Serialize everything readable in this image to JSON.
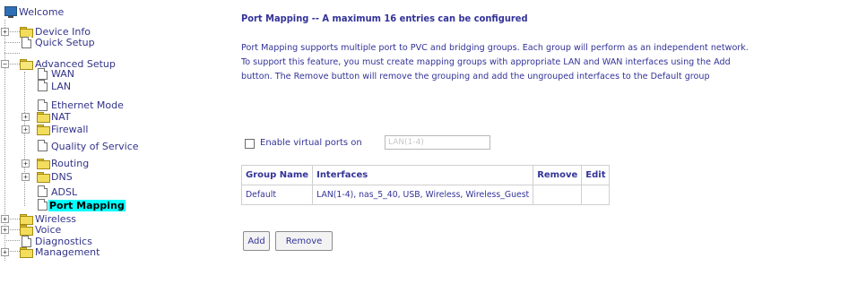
{
  "nav": {
    "items": [
      {
        "label": "Welcome"
      },
      {
        "label": "Device Info"
      },
      {
        "label": "Quick Setup"
      },
      {
        "label": "Advanced Setup"
      },
      {
        "label": "WAN"
      },
      {
        "label": "LAN"
      },
      {
        "label": "Ethernet Mode"
      },
      {
        "label": "NAT"
      },
      {
        "label": "Firewall"
      },
      {
        "label": "Quality of Service"
      },
      {
        "label": "Routing"
      },
      {
        "label": "DNS"
      },
      {
        "label": "ADSL"
      },
      {
        "label": "Port Mapping"
      },
      {
        "label": "Wireless"
      },
      {
        "label": "Voice"
      },
      {
        "label": "Diagnostics"
      },
      {
        "label": "Management"
      }
    ],
    "selected": "Port Mapping"
  },
  "page": {
    "title": "Port Mapping -- A maximum 16 entries can be configured",
    "description": [
      "Port Mapping supports multiple port to PVC and bridging groups. Each group will perform as an independent network.",
      "To support this feature, you must create mapping groups with appropriate LAN and WAN interfaces using the Add",
      "button. The Remove button will remove the grouping and add the ungrouped interfaces to the Default group"
    ],
    "virtual_ports": {
      "label": "Enable virtual ports on",
      "value": "LAN(1-4)",
      "checked": false
    },
    "table": {
      "headers": [
        "Group Name",
        "Interfaces",
        "Remove",
        "Edit"
      ],
      "rows": [
        {
          "group_name": "Default",
          "interfaces": "LAN(1-4), nas_5_40, USB, Wireless, Wireless_Guest",
          "remove": "",
          "edit": ""
        }
      ]
    },
    "buttons": {
      "add": "Add",
      "remove": "Remove"
    }
  }
}
